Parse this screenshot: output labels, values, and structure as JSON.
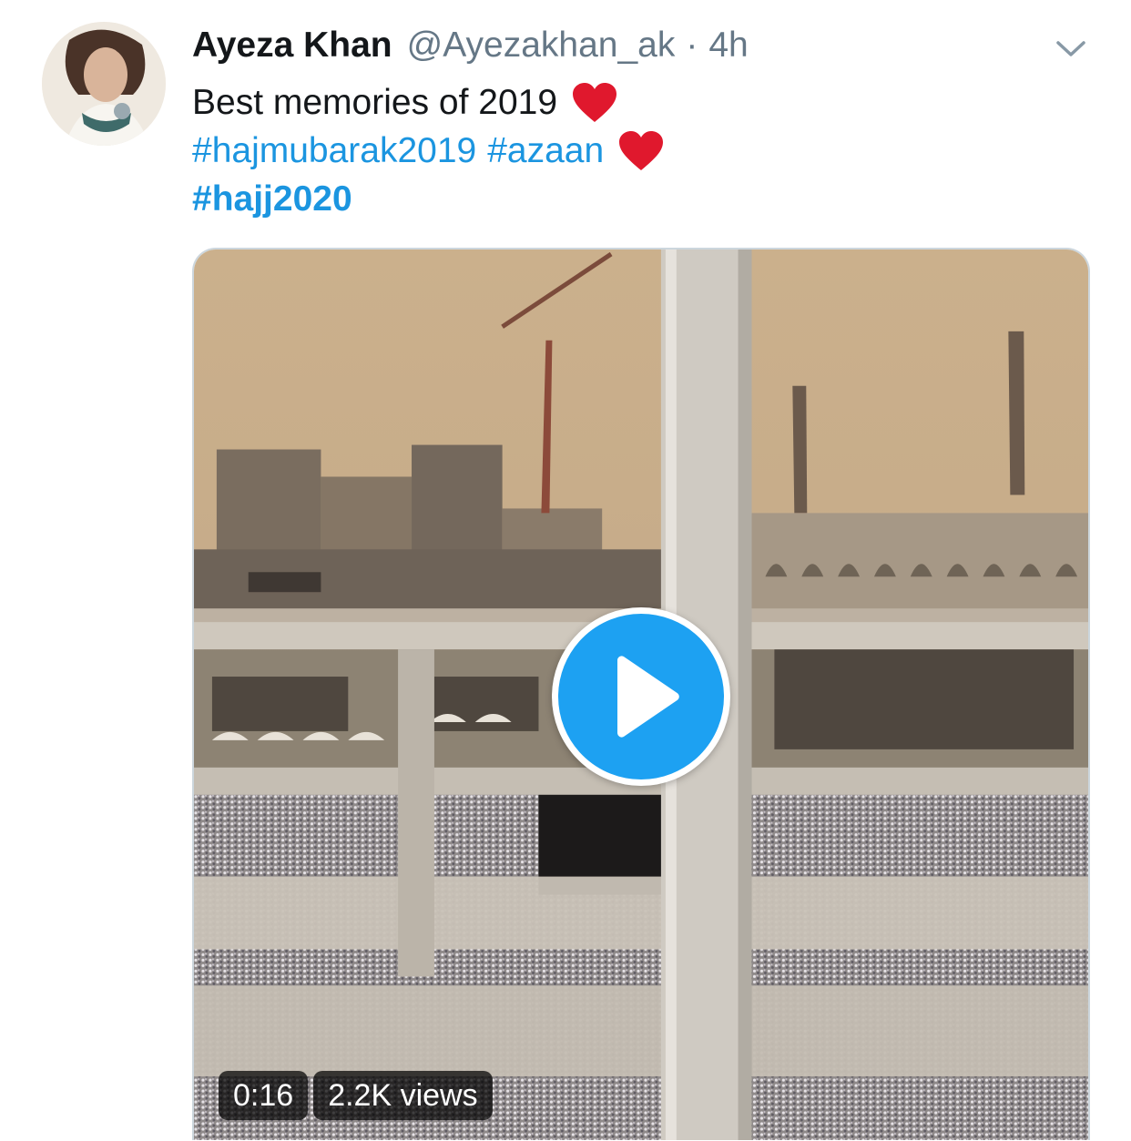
{
  "tweet": {
    "author_name": "Ayeza Khan",
    "handle": "@Ayezakhan_ak",
    "separator": "·",
    "time": "4h",
    "text_line1": "Best memories of 2019",
    "hashtags_line2": [
      "#hajmubarak2019",
      "#azaan"
    ],
    "hashtag_line3": "#hajj2020"
  },
  "media": {
    "duration": "0:16",
    "views": "2.2K views"
  },
  "icons": {
    "heart": "red-heart-icon",
    "caret": "chevron-down-icon",
    "play": "play-icon"
  },
  "colors": {
    "link": "#1b95e0",
    "muted": "#657786",
    "play_button": "#1da1f2",
    "heart": "#e0182d"
  }
}
